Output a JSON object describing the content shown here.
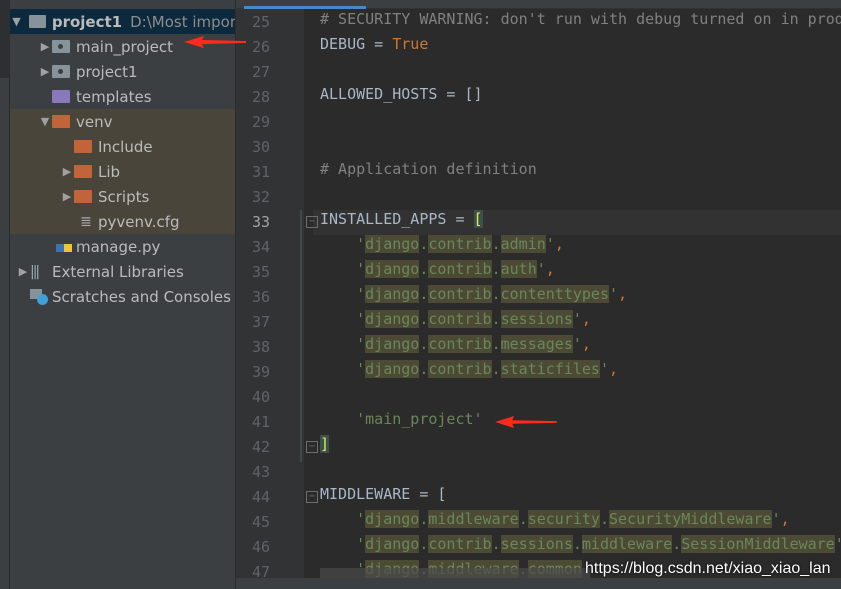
{
  "project_tree": {
    "root": {
      "label": "project1",
      "path": "D:\\Most impor"
    },
    "items": [
      {
        "label": "main_project",
        "icon": "module-folder-icon"
      },
      {
        "label": "project1",
        "icon": "module-folder-icon"
      },
      {
        "label": "templates",
        "icon": "template-folder-icon"
      },
      {
        "label": "venv",
        "icon": "excluded-folder-icon"
      },
      {
        "label": "Include",
        "icon": "excluded-folder-icon"
      },
      {
        "label": "Lib",
        "icon": "excluded-folder-icon"
      },
      {
        "label": "Scripts",
        "icon": "excluded-folder-icon"
      },
      {
        "label": "pyvenv.cfg",
        "icon": "config-file-icon"
      },
      {
        "label": "manage.py",
        "icon": "python-file-icon"
      },
      {
        "label": "External Libraries",
        "icon": "libraries-icon"
      },
      {
        "label": "Scratches and Consoles",
        "icon": "scratches-icon"
      }
    ]
  },
  "editor": {
    "line_numbers": [
      "25",
      "26",
      "27",
      "28",
      "29",
      "30",
      "31",
      "32",
      "33",
      "34",
      "35",
      "36",
      "37",
      "38",
      "39",
      "40",
      "41",
      "42",
      "43",
      "44",
      "45",
      "46",
      "47"
    ],
    "lines": [
      [
        {
          "t": "# SECURITY WARNING: don't run with debug turned on in prod",
          "c": "com"
        }
      ],
      [
        {
          "t": "DEBUG = "
        },
        {
          "t": "True",
          "c": "kw"
        }
      ],
      [],
      [
        {
          "t": "ALLOWED_HOSTS = []"
        }
      ],
      [],
      [],
      [
        {
          "t": "# Application definition",
          "c": "com"
        }
      ],
      [],
      [
        {
          "t": "INSTALLED_APPS = "
        },
        {
          "t": "[",
          "c": "brk"
        }
      ],
      [
        {
          "t": "    "
        },
        {
          "t": "'",
          "c": "str"
        },
        {
          "t": "django",
          "c": "hl"
        },
        {
          "t": ".",
          "c": "str"
        },
        {
          "t": "contrib",
          "c": "hl"
        },
        {
          "t": ".",
          "c": "str"
        },
        {
          "t": "admin",
          "c": "hl"
        },
        {
          "t": "'",
          "c": "str"
        },
        {
          "t": ",",
          "c": "kw"
        }
      ],
      [
        {
          "t": "    "
        },
        {
          "t": "'",
          "c": "str"
        },
        {
          "t": "django",
          "c": "hl"
        },
        {
          "t": ".",
          "c": "str"
        },
        {
          "t": "contrib",
          "c": "hl"
        },
        {
          "t": ".",
          "c": "str"
        },
        {
          "t": "auth",
          "c": "hl"
        },
        {
          "t": "'",
          "c": "str"
        },
        {
          "t": ",",
          "c": "kw"
        }
      ],
      [
        {
          "t": "    "
        },
        {
          "t": "'",
          "c": "str"
        },
        {
          "t": "django",
          "c": "hl"
        },
        {
          "t": ".",
          "c": "str"
        },
        {
          "t": "contrib",
          "c": "hl"
        },
        {
          "t": ".",
          "c": "str"
        },
        {
          "t": "contenttypes",
          "c": "hl"
        },
        {
          "t": "'",
          "c": "str"
        },
        {
          "t": ",",
          "c": "kw"
        }
      ],
      [
        {
          "t": "    "
        },
        {
          "t": "'",
          "c": "str"
        },
        {
          "t": "django",
          "c": "hl"
        },
        {
          "t": ".",
          "c": "str"
        },
        {
          "t": "contrib",
          "c": "hl"
        },
        {
          "t": ".",
          "c": "str"
        },
        {
          "t": "sessions",
          "c": "hl"
        },
        {
          "t": "'",
          "c": "str"
        },
        {
          "t": ",",
          "c": "kw"
        }
      ],
      [
        {
          "t": "    "
        },
        {
          "t": "'",
          "c": "str"
        },
        {
          "t": "django",
          "c": "hl"
        },
        {
          "t": ".",
          "c": "str"
        },
        {
          "t": "contrib",
          "c": "hl"
        },
        {
          "t": ".",
          "c": "str"
        },
        {
          "t": "messages",
          "c": "hl"
        },
        {
          "t": "'",
          "c": "str"
        },
        {
          "t": ",",
          "c": "kw"
        }
      ],
      [
        {
          "t": "    "
        },
        {
          "t": "'",
          "c": "str"
        },
        {
          "t": "django",
          "c": "hl"
        },
        {
          "t": ".",
          "c": "str"
        },
        {
          "t": "contrib",
          "c": "hl"
        },
        {
          "t": ".",
          "c": "str"
        },
        {
          "t": "staticfiles",
          "c": "hl"
        },
        {
          "t": "'",
          "c": "str"
        },
        {
          "t": ",",
          "c": "kw"
        }
      ],
      [],
      [
        {
          "t": "    "
        },
        {
          "t": "'main_project'",
          "c": "str"
        }
      ],
      [
        {
          "t": "]",
          "c": "brk"
        }
      ],
      [],
      [
        {
          "t": "MIDDLEWARE = ["
        }
      ],
      [
        {
          "t": "    "
        },
        {
          "t": "'",
          "c": "str"
        },
        {
          "t": "django",
          "c": "hl"
        },
        {
          "t": ".",
          "c": "str"
        },
        {
          "t": "middleware",
          "c": "hl"
        },
        {
          "t": ".",
          "c": "str"
        },
        {
          "t": "security",
          "c": "hl"
        },
        {
          "t": ".",
          "c": "str"
        },
        {
          "t": "SecurityMiddleware",
          "c": "hl"
        },
        {
          "t": "'",
          "c": "str"
        },
        {
          "t": ",",
          "c": "kw"
        }
      ],
      [
        {
          "t": "    "
        },
        {
          "t": "'",
          "c": "str"
        },
        {
          "t": "django",
          "c": "hl"
        },
        {
          "t": ".",
          "c": "str"
        },
        {
          "t": "contrib",
          "c": "hl"
        },
        {
          "t": ".",
          "c": "str"
        },
        {
          "t": "sessions",
          "c": "hl"
        },
        {
          "t": ".",
          "c": "str"
        },
        {
          "t": "middleware",
          "c": "hl"
        },
        {
          "t": ".",
          "c": "str"
        },
        {
          "t": "SessionMiddleware",
          "c": "hl"
        },
        {
          "t": "'",
          "c": "str"
        }
      ],
      [
        {
          "t": "    "
        },
        {
          "t": "'",
          "c": "str"
        },
        {
          "t": "django",
          "c": "hl"
        },
        {
          "t": ".",
          "c": "str"
        },
        {
          "t": "middleware",
          "c": "hl"
        },
        {
          "t": ".",
          "c": "str"
        },
        {
          "t": "common",
          "c": "hl"
        },
        {
          "t": ".",
          "c": "str"
        }
      ]
    ]
  },
  "watermark": "https://blog.csdn.net/xiao_xiao_lan",
  "colors": {
    "annotation_arrow": "#ff2a1a",
    "tab_underline": "#4a88c7"
  }
}
